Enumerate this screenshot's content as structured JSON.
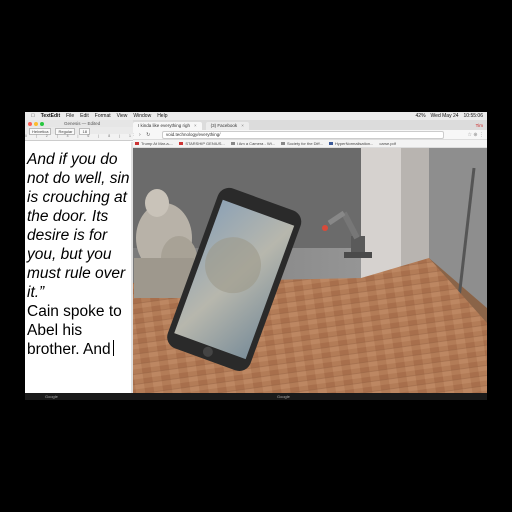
{
  "menubar": {
    "app": "TextEdit",
    "items": [
      "File",
      "Edit",
      "Format",
      "View",
      "Window",
      "Help"
    ],
    "status": [
      "Wed May 24",
      "10:55:06",
      "42%"
    ]
  },
  "browser": {
    "tabs": [
      {
        "label": "I kinda like everything righ",
        "close": "×"
      },
      {
        "label": "(3) Facebook",
        "close": "×"
      }
    ],
    "user": "Tim",
    "nav": "‹ › ↻",
    "url": "void.technology/everything/",
    "bookmarks": [
      "Trump At Mar-a-...",
      "STARSHIP GENIUS...",
      "I Am a Camera - Wi...",
      "Society for the Diff...",
      "HyperNormalisation...",
      "carse.pdf"
    ]
  },
  "textedit": {
    "title": "Genesis — Edited",
    "toolbar": [
      "Helvetica",
      "Regular",
      "18"
    ],
    "ruler": "0 | 2 | 4 | 6 | 8 | 10",
    "italic_text": "And if you do not do well, sin is crouching at the door. Its desire is for you, but you must rule over it.”",
    "body_text": "Cain spoke to Abel his brother. And"
  },
  "footer": {
    "left": "Google",
    "right": "Google"
  },
  "colors": {
    "floor": "#b07a55",
    "walls": "#8c8c8c",
    "phone": "#2a2a2a"
  }
}
